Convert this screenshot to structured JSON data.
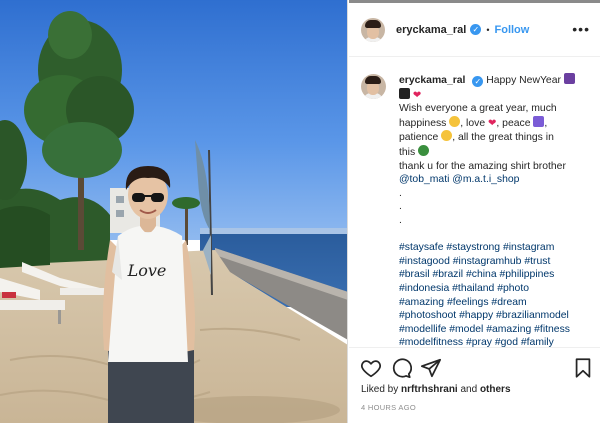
{
  "post": {
    "username": "eryckama_ral",
    "follow_label": "Follow",
    "separator": "•",
    "more_label": "•••"
  },
  "caption": {
    "username": "eryckama_ral",
    "greeting": "Happy NewYear",
    "line1": "Wish everyone a great year, much",
    "line2_a": "happiness",
    "line2_b": ", love",
    "line2_c": ", peace",
    "line3_a": "patience",
    "line3_b": ", all the great things in",
    "line4": "this",
    "line5": "thank u for the amazing shirt brother",
    "mention1": "@tob_mati",
    "mention2": "@m.a.t.i_shop",
    "dots": [
      ".",
      ".",
      "."
    ],
    "hashtag_lines": [
      "#staysafe #staystrong #instagram",
      "#instagood #instagramhub #trust",
      "#brasil #brazil #china #philippines",
      "#indonesia #thailand #photo",
      "#amazing #feelings #dream",
      "#photoshoot #happy #brazilianmodel",
      "#modellife #model #amazing #fitness",
      "#modelfitness #pray #god #family"
    ]
  },
  "footer": {
    "liked_by_prefix": "Liked by",
    "liked_by_user": "nrftrhshrani",
    "and_label": "and",
    "others_label": "others",
    "timestamp": "4 HOURS AGO"
  },
  "photo": {
    "shirt_text": "Love"
  },
  "colors": {
    "accent": "#3897f0",
    "text": "#262626",
    "secondary": "#8e8e8e",
    "hashtag": "#00376b",
    "heart": "#e0245e"
  },
  "icons": {
    "like": "heart-outline-icon",
    "comment": "comment-bubble-icon",
    "share": "paper-plane-icon",
    "save": "bookmark-icon",
    "verified": "verified-badge-icon"
  }
}
